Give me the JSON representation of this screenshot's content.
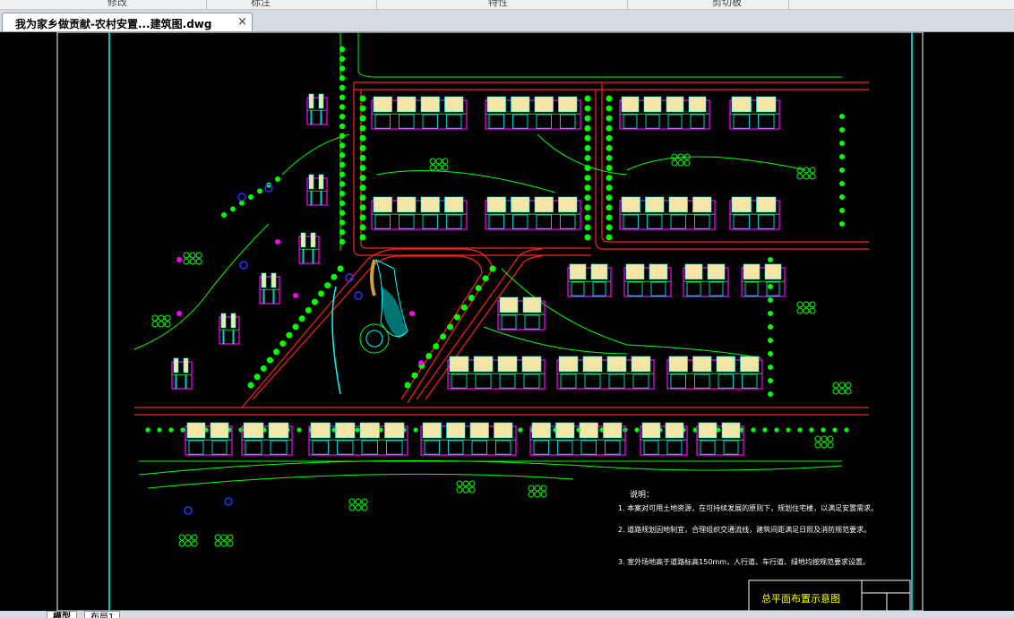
{
  "ribbon": {
    "panels": [
      "修改",
      "标注",
      "特性",
      "剪切板"
    ]
  },
  "document_tab": {
    "title": "我为家乡做贡献-农村安置...建筑图.dwg",
    "close_glyph": "×"
  },
  "notes": {
    "heading": "说明：",
    "items": [
      "1. 本案对可用土地资源，在可持续发展的原则下，规划住宅楼，以满足安置需求。",
      "2. 道路规划因地制宜，合理组织交通流线，建筑间距满足日照及消防规范要求。",
      "3. 室外场地高于道路标高150mm，人行道、车行道、绿地均按规范要求设置。"
    ]
  },
  "title_block": {
    "drawing_title": "总平面布置示意图"
  },
  "layout_tabs": [
    "模型",
    "布局1"
  ],
  "colors": {
    "canvas": "#000000",
    "road": "#ff2020",
    "green": "#00ff00",
    "building_fill": "#f5e6a8",
    "building_outline": "#ff00ff",
    "cyan": "#00ffff",
    "blue": "#3030ff",
    "frame": "#ffffff",
    "title_text": "#ffff00"
  }
}
